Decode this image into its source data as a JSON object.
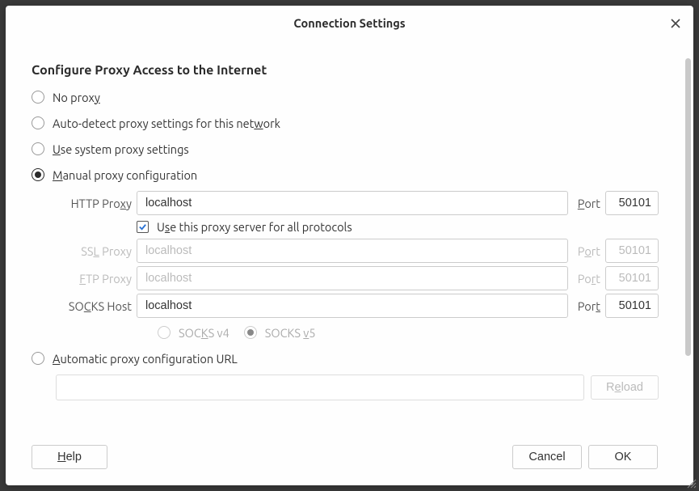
{
  "dialog": {
    "title": "Connection Settings"
  },
  "section": {
    "heading": "Configure Proxy Access to the Internet"
  },
  "options": {
    "no_proxy": {
      "pre": "No prox",
      "u": "y",
      "post": ""
    },
    "auto_detect": {
      "pre": "Auto-detect proxy settings for this net",
      "u": "w",
      "post": "ork"
    },
    "system": {
      "pre": "",
      "u": "U",
      "post": "se system proxy settings"
    },
    "manual": {
      "pre": "",
      "u": "M",
      "post": "anual proxy configuration"
    },
    "auto_url": {
      "pre": "",
      "u": "A",
      "post": "utomatic proxy configuration URL"
    }
  },
  "proxy": {
    "http": {
      "label_pre": "HTTP Pro",
      "label_u": "x",
      "label_post": "y",
      "host": "localhost",
      "port_label_pre": "",
      "port_label_u": "P",
      "port_label_post": "ort",
      "port": "50101"
    },
    "use_all": {
      "pre": "U",
      "u": "s",
      "post": "e this proxy server for all protocols",
      "checked": true
    },
    "ssl": {
      "label_pre": "SS",
      "label_u": "L",
      "label_post": " Proxy",
      "host": "localhost",
      "port_label_pre": "P",
      "port_label_u": "o",
      "port_label_post": "rt",
      "port": "50101"
    },
    "ftp": {
      "label_pre": "",
      "label_u": "F",
      "label_post": "TP Proxy",
      "host": "localhost",
      "port_label_pre": "Po",
      "port_label_u": "r",
      "port_label_post": "t",
      "port": "50101"
    },
    "socks": {
      "label_pre": "SO",
      "label_u": "C",
      "label_post": "KS Host",
      "host": "localhost",
      "port_label_pre": "Por",
      "port_label_u": "t",
      "port_label_post": "",
      "port": "50101"
    },
    "socks_v4": {
      "pre": "SOC",
      "u": "K",
      "post": "S v4"
    },
    "socks_v5": {
      "pre": "SOCKS ",
      "u": "v",
      "post": "5"
    }
  },
  "pac": {
    "url": "",
    "reload": {
      "pre": "R",
      "u": "e",
      "post": "load"
    }
  },
  "footer": {
    "help": {
      "pre": "",
      "u": "H",
      "post": "elp"
    },
    "cancel": "Cancel",
    "ok": "OK"
  }
}
